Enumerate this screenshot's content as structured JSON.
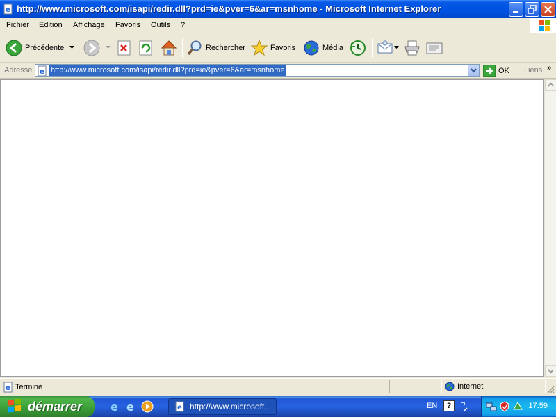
{
  "window": {
    "title": "http://www.microsoft.com/isapi/redir.dll?prd=ie&pver=6&ar=msnhome - Microsoft Internet Explorer"
  },
  "menu": {
    "items": [
      "Fichier",
      "Edition",
      "Affichage",
      "Favoris",
      "Outils",
      "?"
    ]
  },
  "toolbar": {
    "back_label": "Précédente",
    "search_label": "Rechercher",
    "favorites_label": "Favoris",
    "media_label": "Média"
  },
  "address": {
    "label": "Adresse",
    "url": "http://www.microsoft.com/isapi/redir.dll?prd=ie&pver=6&ar=msnhome",
    "go_label": "OK",
    "links_label": "Liens",
    "chevron": "»"
  },
  "status": {
    "text": "Terminé",
    "zone": "Internet"
  },
  "taskbar": {
    "start_label": "démarrer",
    "task_label": "http://www.microsoft...",
    "lang": "EN",
    "help": "?",
    "clock": "17:59"
  },
  "colors": {
    "titlebar": "#0054e3",
    "selection": "#316ac5",
    "start_green": "#3ea33b",
    "tray_blue": "#18b9ee"
  }
}
